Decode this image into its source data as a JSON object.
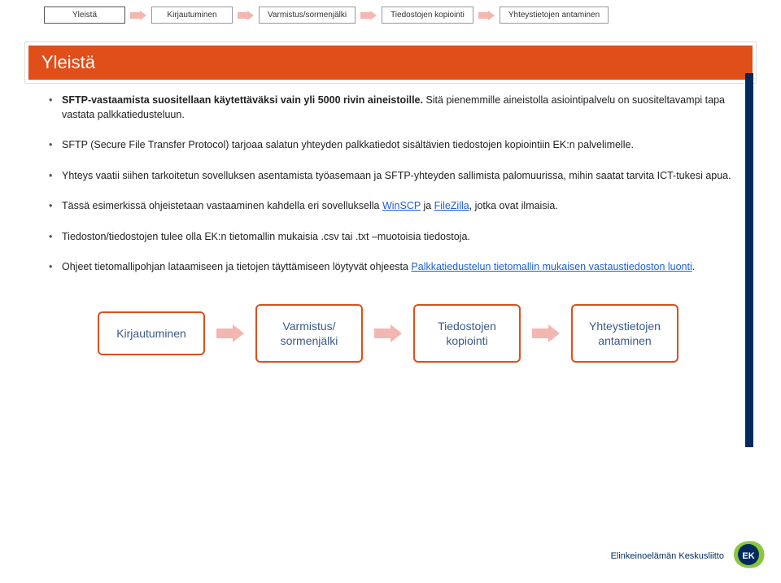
{
  "nav": {
    "step1": "Yleistä",
    "step2": "Kirjautuminen",
    "step3": "Varmistus/sormenjälki",
    "step4": "Tiedostojen kopiointi",
    "step5": "Yhteystietojen antaminen"
  },
  "heading": "Yleistä",
  "bullets": {
    "b1a": "SFTP-vastaamista suositellaan käytettäväksi vain yli 5000 rivin aineistoille.",
    "b1b": " Sitä pienemmille aineistolla asiointipalvelu on suositeltavampi tapa vastata palkkatiedusteluun.",
    "b2": "SFTP (Secure File Transfer Protocol) tarjoaa salatun yhteyden palkkatiedot sisältävien tiedostojen kopiointiin EK:n palvelimelle.",
    "b3": "Yhteys vaatii siihen tarkoitetun sovelluksen asentamista työasemaan ja SFTP-yhteyden sallimista palomuurissa, mihin saatat tarvita ICT-tukesi apua.",
    "b4a": "Tässä esimerkissä ohjeistetaan vastaaminen kahdella eri sovelluksella ",
    "b4_link1": "WinSCP",
    "b4b": " ja ",
    "b4_link2": "FileZilla",
    "b4c": ", jotka ovat ilmaisia.",
    "b5": "Tiedoston/tiedostojen tulee olla EK:n tietomallin mukaisia .csv tai .txt –muotoisia tiedostoja.",
    "b6a": "Ohjeet tietomallipohjan lataamiseen ja tietojen täyttämiseen löytyvät ohjeesta ",
    "b6_link": "Palkkatiedustelun tietomallin mukaisen vastaustiedoston luonti",
    "b6b": "."
  },
  "flow": {
    "s1": "Kirjautuminen",
    "s2a": "Varmistus/",
    "s2b": "sormenjälki",
    "s3a": "Tiedostojen",
    "s3b": "kopiointi",
    "s4a": "Yhteystietojen",
    "s4b": "antaminen"
  },
  "logo": {
    "text": "Elinkeinoelämän Keskusliitto",
    "badge": "EK"
  },
  "colors": {
    "accent_orange": "#e04e1a",
    "accent_navy": "#002a5c",
    "arrow_pink": "#f4b6b1",
    "link": "#1a5fd6"
  }
}
